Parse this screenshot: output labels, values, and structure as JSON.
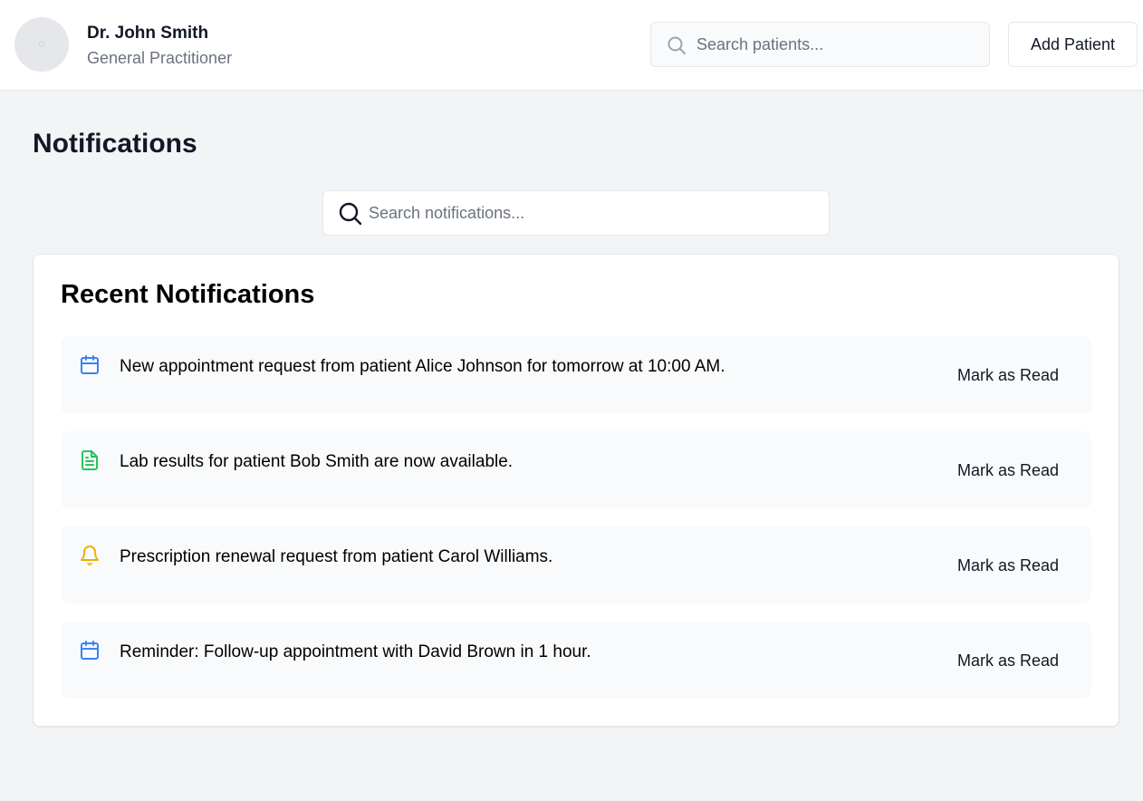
{
  "header": {
    "doctor_name": "Dr. John Smith",
    "doctor_role": "General Practitioner",
    "search_placeholder": "Search patients...",
    "search_value": "",
    "add_patient_label": "Add Patient"
  },
  "page": {
    "title": "Notifications",
    "search_placeholder": "Search notifications...",
    "search_value": ""
  },
  "card": {
    "title": "Recent Notifications",
    "items": [
      {
        "icon": "calendar-icon",
        "icon_color": "#3b82f6",
        "message": "New appointment request from patient Alice Johnson for tomorrow at 10:00 AM.",
        "action_label": "Mark as Read"
      },
      {
        "icon": "document-icon",
        "icon_color": "#22c55e",
        "message": "Lab results for patient Bob Smith are now available.",
        "action_label": "Mark as Read"
      },
      {
        "icon": "bell-icon",
        "icon_color": "#eab308",
        "message": "Prescription renewal request from patient Carol Williams.",
        "action_label": "Mark as Read"
      },
      {
        "icon": "calendar-icon",
        "icon_color": "#3b82f6",
        "message": "Reminder: Follow-up appointment with David Brown in 1 hour.",
        "action_label": "Mark as Read"
      }
    ]
  },
  "colors": {
    "page_background": "#f3f4f6",
    "card_background": "#ffffff",
    "item_background": "#f9fafb",
    "muted_text": "#6b7280"
  }
}
